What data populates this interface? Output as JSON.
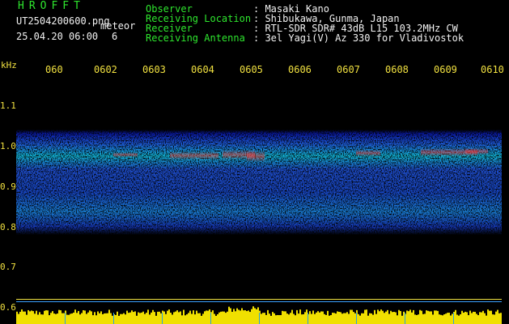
{
  "brand": "HROFFT",
  "file_name": "UT2504200600.png",
  "label_meteor": "meteor",
  "datetime": "25.04.20 06:00",
  "meteor_count": "6",
  "header": [
    {
      "label": "Observer",
      "value": ": Masaki Kano"
    },
    {
      "label": "Receiving Location",
      "value": ": Shibukawa, Gunma, Japan"
    },
    {
      "label": "Receiver",
      "value": ": RTL-SDR SDR# 43dB L15 103.2MHz CW"
    },
    {
      "label": "Receiving Antenna",
      "value": ": 3el Yagi(V) Az 330 for Vladivostok"
    }
  ],
  "axis_unit": "kHz",
  "y_ticks": [
    "1.1",
    "1.0",
    "0.9",
    "0.8",
    "0.7",
    "0.6"
  ],
  "time_ticks": [
    "060",
    "0602",
    "0603",
    "0604",
    "0605",
    "0606",
    "0607",
    "0608",
    "0609",
    "0610"
  ],
  "colors": {
    "label": "#2ee62e",
    "text": "#f2f2f2",
    "axis": "#f0e040",
    "signal": "#f0e000"
  }
}
